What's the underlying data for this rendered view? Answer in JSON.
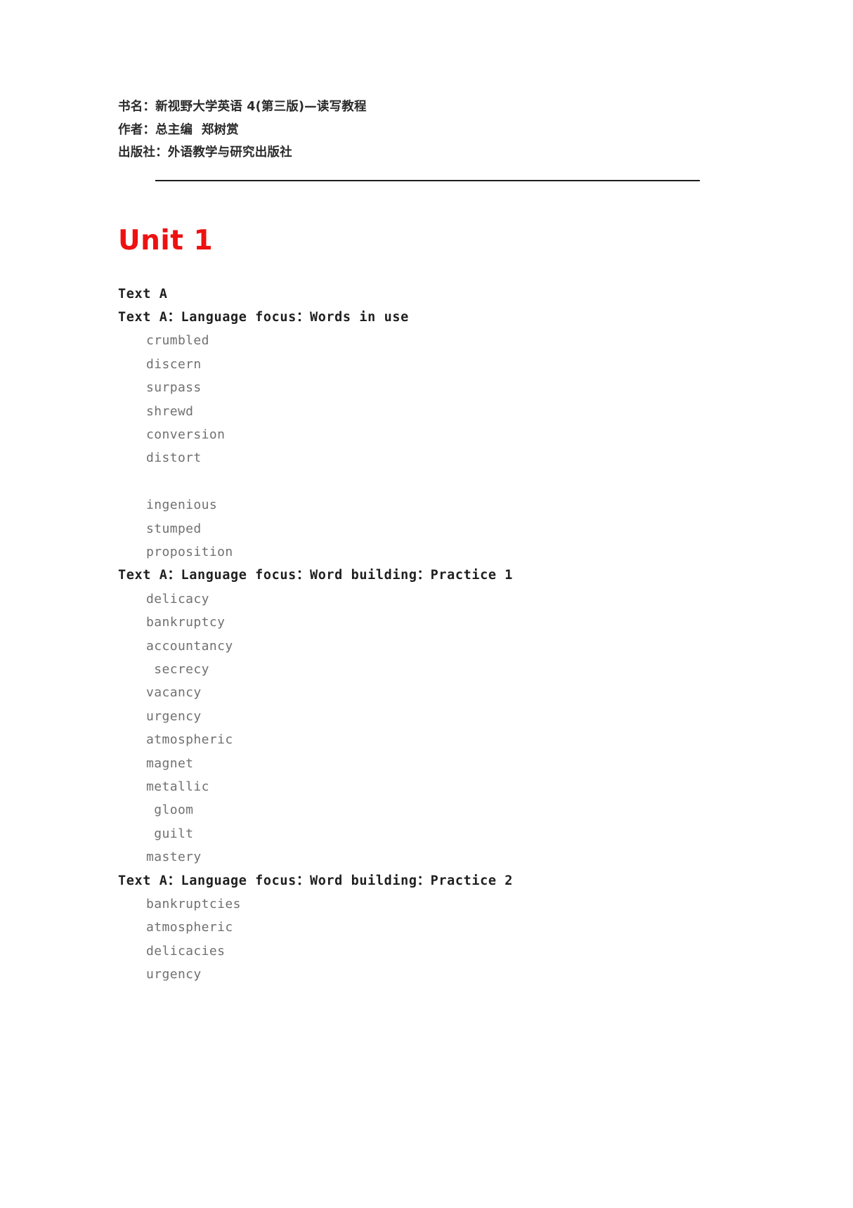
{
  "document": {
    "book_info": [
      {
        "label": "书名：",
        "value": "新视野大学英语 4(第三版)—读写教程"
      },
      {
        "label": "作者：",
        "value": "总主编  郑树赏"
      },
      {
        "label": "出版社：",
        "value": "外语教学与研究出版社"
      }
    ],
    "book_info_lines": [
      "书名：新视野大学英语 4(第三版)—读写教程",
      "作者：总主编  郑树赏",
      "出版社：外语教学与研究出版社"
    ],
    "unit_title": "Unit 1",
    "unit_title_color": "#ee1111",
    "blocks": [
      {
        "heading": "Text A",
        "items": []
      },
      {
        "heading": "Text A：Language focus：Words in use",
        "items": [
          "crumbled",
          "discern",
          "surpass",
          "shrewd",
          "conversion",
          "distort",
          "",
          "ingenious",
          "stumped",
          "proposition"
        ]
      },
      {
        "heading": "Text A：Language focus：Word building：Practice 1",
        "items": [
          "delicacy",
          "bankruptcy",
          "accountancy",
          " secrecy",
          "vacancy",
          "urgency",
          "atmospheric",
          "magnet",
          "metallic",
          " gloom",
          " guilt",
          "mastery"
        ]
      },
      {
        "heading": "Text A：Language focus：Word building：Practice 2",
        "items": [
          "bankruptcies",
          "atmospheric",
          "delicacies",
          "urgency"
        ]
      }
    ]
  }
}
